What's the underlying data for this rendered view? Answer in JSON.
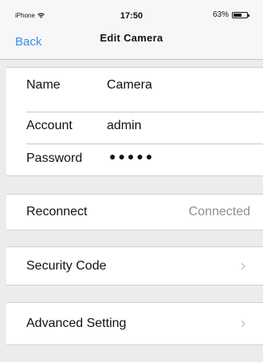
{
  "status_bar": {
    "carrier": "iPhone",
    "time": "17:50",
    "battery_percent": "63%",
    "battery_level": 0.63,
    "wifi_icon": "wifi-icon",
    "battery_icon": "battery-icon"
  },
  "nav": {
    "back_label": "Back",
    "title": "Edit Camera"
  },
  "credentials": {
    "name_label": "Name",
    "name_value": "Camera",
    "account_label": "Account",
    "account_value": "admin",
    "password_label": "Password",
    "password_mask": "●●●●●"
  },
  "reconnect": {
    "label": "Reconnect",
    "status": "Connected"
  },
  "security": {
    "label": "Security Code",
    "chevron_icon": "chevron-right-icon"
  },
  "advanced": {
    "label": "Advanced Setting",
    "chevron_icon": "chevron-right-icon"
  },
  "colors": {
    "accent": "#3b8ee6",
    "background": "#ececed",
    "cell": "#ffffff",
    "secondary_text": "#8e8e93",
    "separator": "#c8c8cc"
  }
}
